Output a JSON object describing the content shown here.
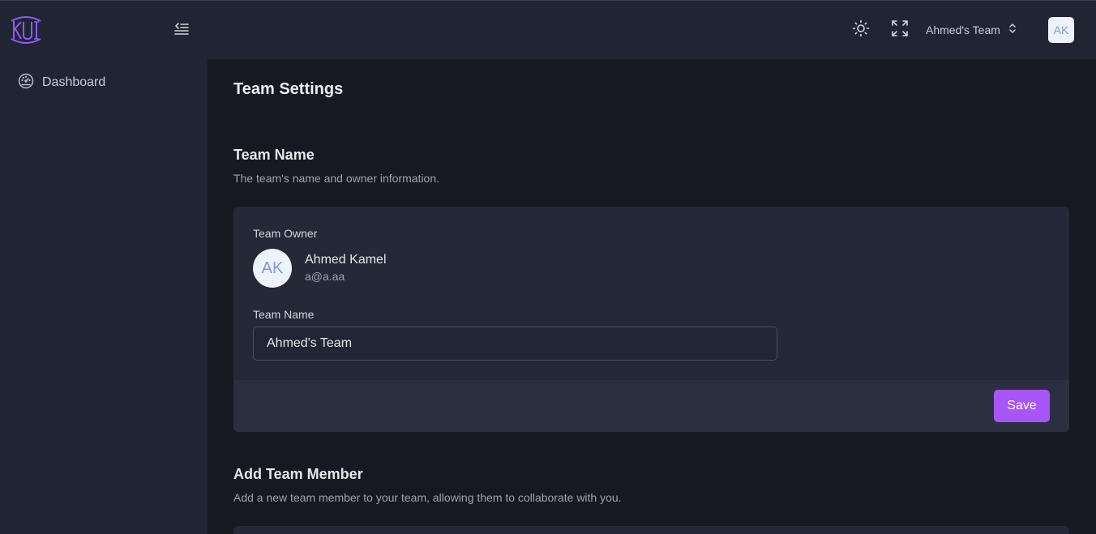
{
  "header": {
    "team_switcher_label": "Ahmed's Team",
    "avatar_initials": "AK"
  },
  "sidebar": {
    "logo_text": "KUI",
    "items": [
      {
        "label": "Dashboard",
        "icon": "gauge-icon"
      }
    ]
  },
  "main": {
    "page_title": "Team Settings",
    "team_name_section": {
      "title": "Team Name",
      "description": "The team's name and owner information.",
      "owner_label": "Team Owner",
      "owner": {
        "initials": "AK",
        "name": "Ahmed Kamel",
        "email": "a@a.aa"
      },
      "team_name_label": "Team Name",
      "team_name_value": "Ahmed's Team",
      "save_label": "Save"
    },
    "add_member_section": {
      "title": "Add Team Member",
      "description": "Add a new team member to your team, allowing them to collaborate with you."
    }
  },
  "colors": {
    "accent": "#a855f7",
    "logo": "#8b5cf6",
    "sidebar_bg": "#212433",
    "page_bg": "#161822",
    "card_bg": "#252837"
  }
}
